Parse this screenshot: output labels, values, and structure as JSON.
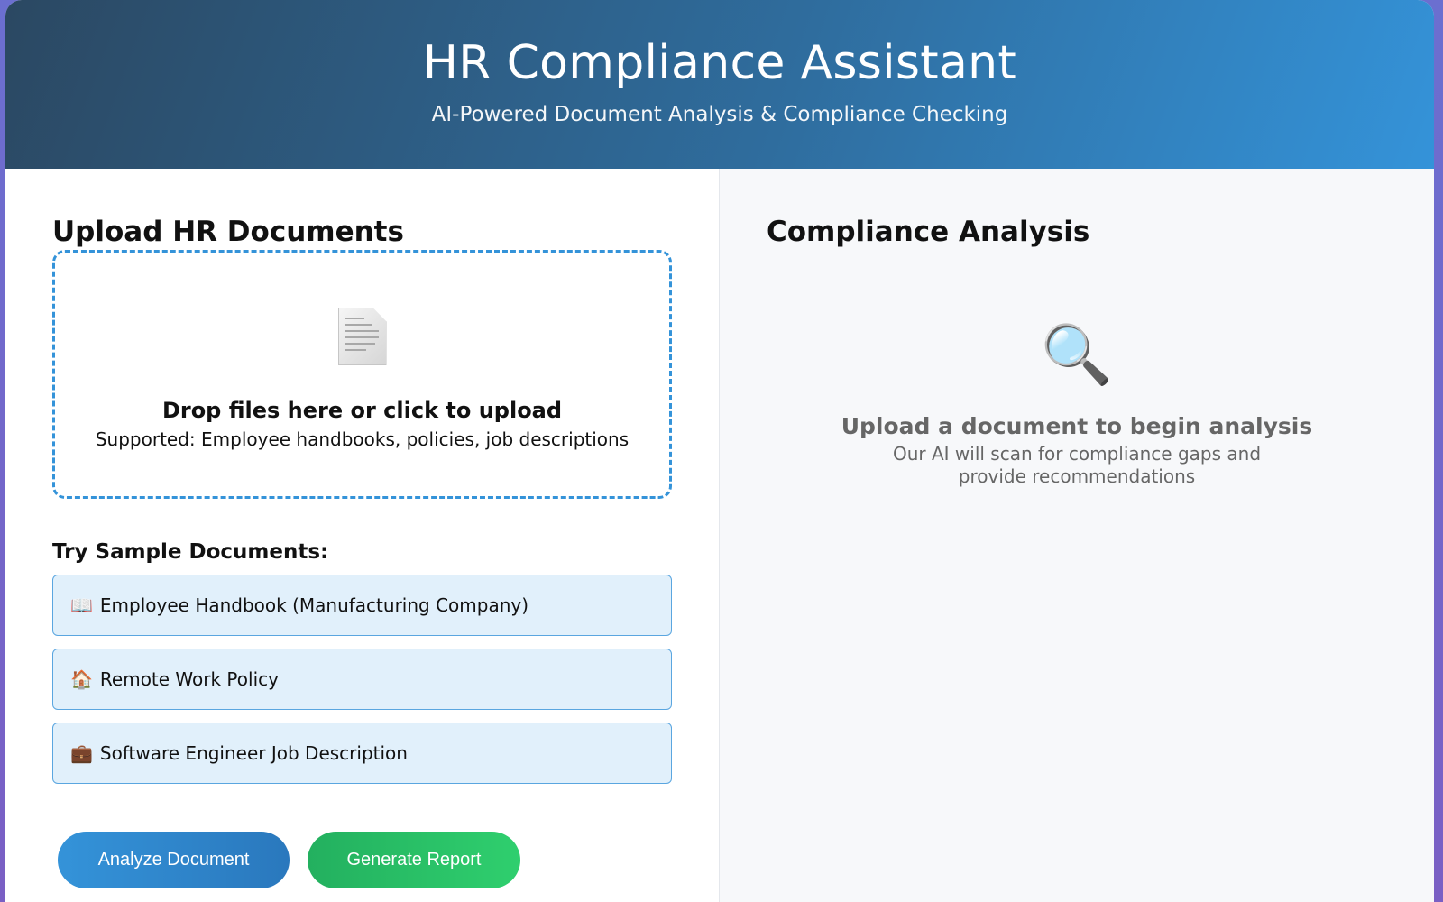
{
  "header": {
    "title": "HR Compliance Assistant",
    "subtitle": "AI-Powered Document Analysis & Compliance Checking"
  },
  "upload": {
    "title": "Upload HR Documents",
    "drop_title": "Drop files here or click to upload",
    "drop_subtitle": "Supported: Employee handbooks, policies, job descriptions",
    "icon": "document-icon"
  },
  "samples": {
    "title": "Try Sample Documents:",
    "items": [
      {
        "emoji": "📖",
        "label": "Employee Handbook (Manufacturing Company)"
      },
      {
        "emoji": "🏠",
        "label": "Remote Work Policy"
      },
      {
        "emoji": "💼",
        "label": "Software Engineer Job Description"
      }
    ]
  },
  "actions": {
    "analyze_label": "Analyze Document",
    "report_label": "Generate Report"
  },
  "analysis": {
    "title": "Compliance Analysis",
    "icon": "🔍",
    "empty_title": "Upload a document to begin analysis",
    "empty_subtitle": "Our AI will scan for compliance gaps and provide recommendations"
  },
  "colors": {
    "accent_blue": "#3493d9",
    "accent_green": "#2fcf6e",
    "header_dark": "#2b4862"
  }
}
